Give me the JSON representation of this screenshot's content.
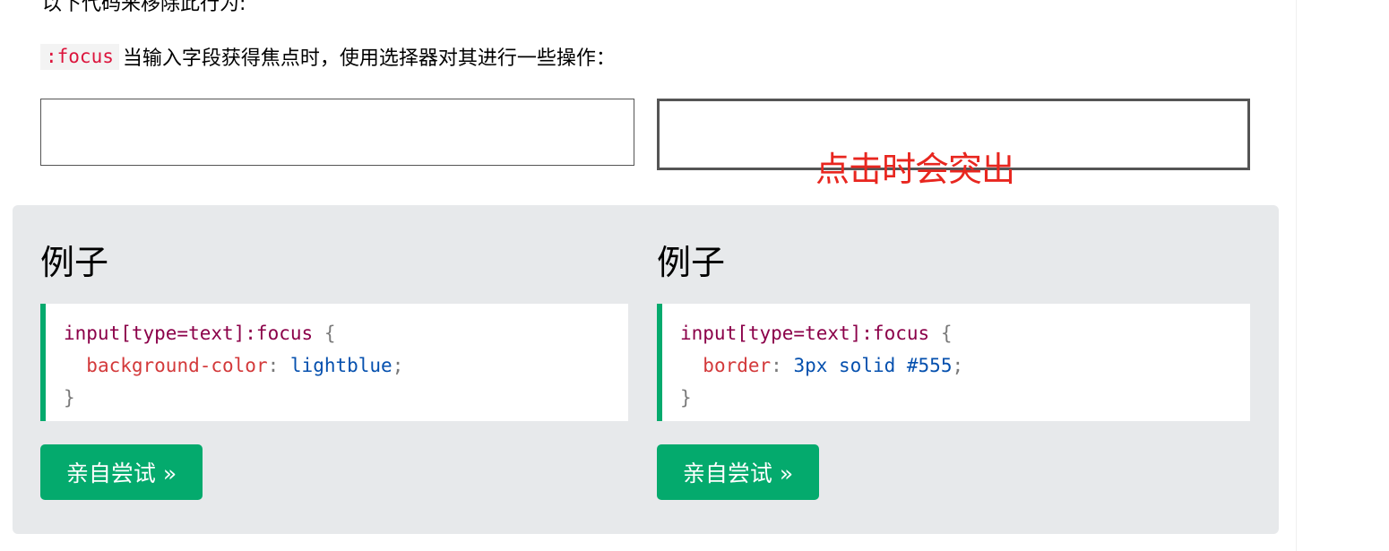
{
  "top_partial_text": "以下代码来移除此行为:",
  "intro": {
    "code": ":focus",
    "text": "当输入字段获得焦点时，使用选择器对其进行一些操作："
  },
  "annotation": "点击时会突出",
  "examples": [
    {
      "heading": "例子",
      "code": {
        "selector": "input[type=text]:focus",
        "open_brace": "{",
        "property": "background-color",
        "colon": ":",
        "value": "lightblue",
        "semicolon": ";",
        "close_brace": "}"
      },
      "button_label": "亲自尝试 »"
    },
    {
      "heading": "例子",
      "code": {
        "selector": "input[type=text]:focus",
        "open_brace": "{",
        "property": "border",
        "colon": ":",
        "value": "3px solid #555",
        "semicolon": ";",
        "close_brace": "}"
      },
      "button_label": "亲自尝试 »"
    }
  ],
  "colors": {
    "accent_green": "#04aa6d",
    "annotation_red": "#e8261f",
    "example_background": "#e7e9eb",
    "focused_border": "#555555"
  }
}
